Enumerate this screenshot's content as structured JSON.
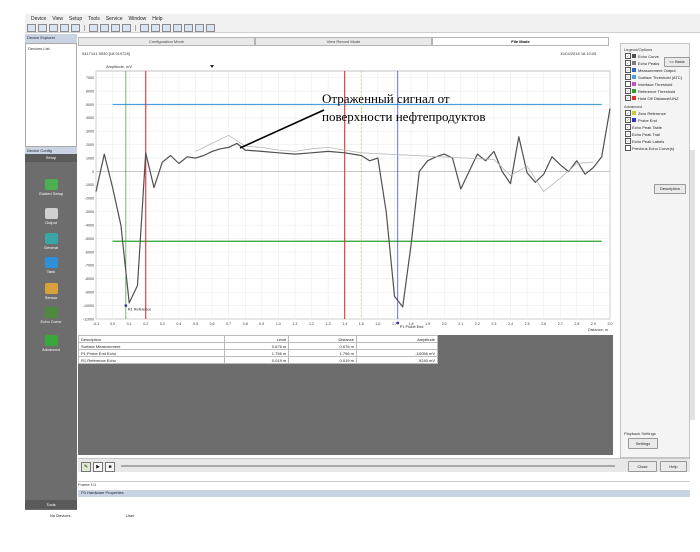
{
  "menu": [
    "Device",
    "View",
    "Setup",
    "Tools",
    "Service",
    "Window",
    "Help"
  ],
  "left_panel": {
    "device_explorer_title": "Device Explorer",
    "device_item": "Devices List",
    "device_config_title": "Device Config",
    "setup_label": "Setup",
    "nav": [
      {
        "label": "Guided Setup",
        "icon": "guided-setup-icon",
        "color": "#4caf50"
      },
      {
        "label": "Output",
        "icon": "output-icon",
        "color": "#d0d0d0"
      },
      {
        "label": "General",
        "icon": "general-icon",
        "color": "#3aa5a5"
      },
      {
        "label": "Tank",
        "icon": "tank-icon",
        "color": "#2f8fd8"
      },
      {
        "label": "Sensor",
        "icon": "sensor-icon",
        "color": "#d9a13a"
      },
      {
        "label": "Echo Curve",
        "icon": "echo-curve-icon",
        "color": "#4d8a3b"
      },
      {
        "label": "Advanced",
        "icon": "advanced-icon",
        "color": "#39a83b"
      }
    ],
    "tools_label": "Tools"
  },
  "modes": [
    {
      "label": "Configuration Mode",
      "active": false
    },
    {
      "label": "View Record Mode",
      "active": false
    },
    {
      "label": "File Mode",
      "active": true
    }
  ],
  "chart_header": {
    "title": "5417141 5540 [18.919728]",
    "date": "11/04/2016 16:10:05",
    "legend_amp": "Amplitude, mV",
    "distance_label": "Distance, m"
  },
  "annotation": {
    "line1": "Отраженный сигнал от",
    "line2": "поверхности нефтепродуктов"
  },
  "chart_data": {
    "type": "line",
    "xlabel": "Distance, m",
    "ylabel": "Amplitude, mV",
    "xlim": [
      -0.1,
      3.0
    ],
    "ylim": [
      -11000,
      7500
    ],
    "x_ticks": [
      "-0.1",
      "0.0",
      "0.1",
      "0.2",
      "0.3",
      "0.4",
      "0.5",
      "0.6",
      "0.7",
      "0.8",
      "0.9",
      "1.0",
      "1.1",
      "1.2",
      "1.3",
      "1.4",
      "1.5",
      "1.6",
      "1.7",
      "1.8",
      "1.9",
      "2.0",
      "2.1",
      "2.2",
      "2.3",
      "2.4",
      "2.5",
      "2.6",
      "2.7",
      "2.8",
      "2.9",
      "3.0"
    ],
    "y_ticks": [
      "7000",
      "6000",
      "5000",
      "4000",
      "3000",
      "2000",
      "1000",
      "0",
      "-1000",
      "-2000",
      "-3000",
      "-4000",
      "-5000",
      "-6000",
      "-7000",
      "-8000",
      "-9000",
      "-10000",
      "-11000"
    ],
    "series": [
      {
        "role": "echo",
        "color": "#505050",
        "x": [
          -0.1,
          -0.05,
          0.0,
          0.05,
          0.1,
          0.15,
          0.2,
          0.25,
          0.3,
          0.35,
          0.4,
          0.45,
          0.5,
          0.55,
          0.6,
          0.65,
          0.7,
          0.75,
          0.8,
          0.9,
          1.0,
          1.1,
          1.2,
          1.3,
          1.4,
          1.5,
          1.55,
          1.6,
          1.65,
          1.7,
          1.75,
          1.8,
          1.85,
          1.9,
          1.95,
          2.0,
          2.05,
          2.1,
          2.15,
          2.2,
          2.25,
          2.3,
          2.35,
          2.4,
          2.45,
          2.5,
          2.55,
          2.6,
          2.65,
          2.7,
          2.75,
          2.8,
          2.85,
          2.9,
          2.95,
          3.0
        ],
        "y": [
          -1500,
          1300,
          -1200,
          -4000,
          -9800,
          -8500,
          1400,
          -1200,
          700,
          1200,
          600,
          1100,
          1000,
          1200,
          1500,
          1700,
          1800,
          2100,
          1600,
          1500,
          1400,
          1300,
          1400,
          1500,
          1400,
          1200,
          800,
          1000,
          -3000,
          -9300,
          -10100,
          -5500,
          0,
          800,
          1100,
          1300,
          1000,
          -1300,
          0,
          1300,
          800,
          1500,
          0,
          -900,
          2600,
          -100,
          -800,
          -200,
          1100,
          500,
          0,
          800,
          -200,
          300,
          1100,
          4700
        ]
      },
      {
        "role": "echo-peak-trail",
        "color": "#b8b8b8",
        "x": [
          0.5,
          0.6,
          0.7,
          0.8,
          0.9,
          1.0,
          1.1,
          1.2,
          1.3,
          1.4,
          1.5,
          2.3,
          2.4,
          2.5,
          2.6,
          2.7,
          2.8,
          2.9
        ],
        "y": [
          1500,
          2100,
          2700,
          1900,
          1800,
          1600,
          1500,
          1700,
          1800,
          1600,
          1400,
          900,
          -300,
          400,
          -1500,
          -500,
          600,
          700
        ]
      }
    ],
    "horizontal_lines": [
      {
        "role": "surface-threshold",
        "color": "#4a9fd8",
        "y": 5000
      },
      {
        "role": "reference-threshold",
        "color": "#2ca02c",
        "y": -5200
      }
    ],
    "vertical_markers": [
      {
        "role": "reference-red-1",
        "color": "#e03030",
        "x": 0.2
      },
      {
        "role": "reference-red-2",
        "color": "#e03030",
        "x": 1.4
      },
      {
        "role": "threshold-yellow",
        "color": "#c8c83a",
        "x": 1.5
      },
      {
        "role": "reference-green",
        "color": "#2ca02c",
        "x": 0.08
      },
      {
        "role": "probe-end-blue",
        "color": "#3030c8",
        "x": 1.72
      }
    ],
    "point_labels": [
      {
        "text": "R1 Reference",
        "x": 0.08,
        "y": -10000
      },
      {
        "text": "P1 Probe End",
        "x": 1.72,
        "y": -11300
      }
    ]
  },
  "table": {
    "headers": [
      "Description",
      "Level",
      "Distance",
      "Amplitude"
    ],
    "rows": [
      [
        "Surface Measurement",
        "0.676 m",
        "0.676 m",
        ""
      ],
      [
        "P1 Probe End Echo",
        "1.756 m",
        "1.756 m",
        "-10056 mV"
      ],
      [
        "R1 Reference Echo",
        "0.019 m",
        "0.019 m",
        "-9240 mV"
      ]
    ]
  },
  "legend_options": {
    "title": "Legend/Options",
    "items": [
      {
        "label": "Echo Curve",
        "checked": true,
        "color": "#505050"
      },
      {
        "label": "Echo Peaks",
        "checked": true,
        "color": "#7c7c7c"
      },
      {
        "label": "Measurement Output",
        "checked": true,
        "color": "#2c66c0"
      },
      {
        "label": "Surface Threshold (ATC)",
        "checked": true,
        "color": "#4a9fd8"
      },
      {
        "label": "Interface Threshold",
        "checked": false,
        "color": "#c050c0"
      },
      {
        "label": "Reference Threshold",
        "checked": true,
        "color": "#2ca02c"
      },
      {
        "label": "Hold Off Distance/UNZ",
        "checked": true,
        "color": "#e03030"
      }
    ],
    "advanced_title": "Advanced",
    "advanced_items": [
      {
        "label": "Zero Reference",
        "checked": true,
        "color": "#c8c83a"
      },
      {
        "label": "Probe End",
        "checked": true,
        "color": "#3030c8"
      },
      {
        "label": "Echo Peak Table",
        "checked": true,
        "color": ""
      },
      {
        "label": "Echo Peak Trail",
        "checked": true,
        "color": ""
      },
      {
        "label": "Echo Peak Labels",
        "checked": true,
        "color": ""
      },
      {
        "label": "Previous Echo Curve(s)",
        "checked": false,
        "color": ""
      }
    ],
    "basic_button": "<< Basic",
    "description_button": "Description",
    "playback_title": "Playback Settings",
    "settings_button": "Settings"
  },
  "playback": {
    "close_button": "Close",
    "help_button": "Help",
    "frame_label": "Frame 1/1",
    "property_header": "P3 Hardware Properties"
  },
  "status": {
    "left": "No Devices",
    "right": "User"
  }
}
